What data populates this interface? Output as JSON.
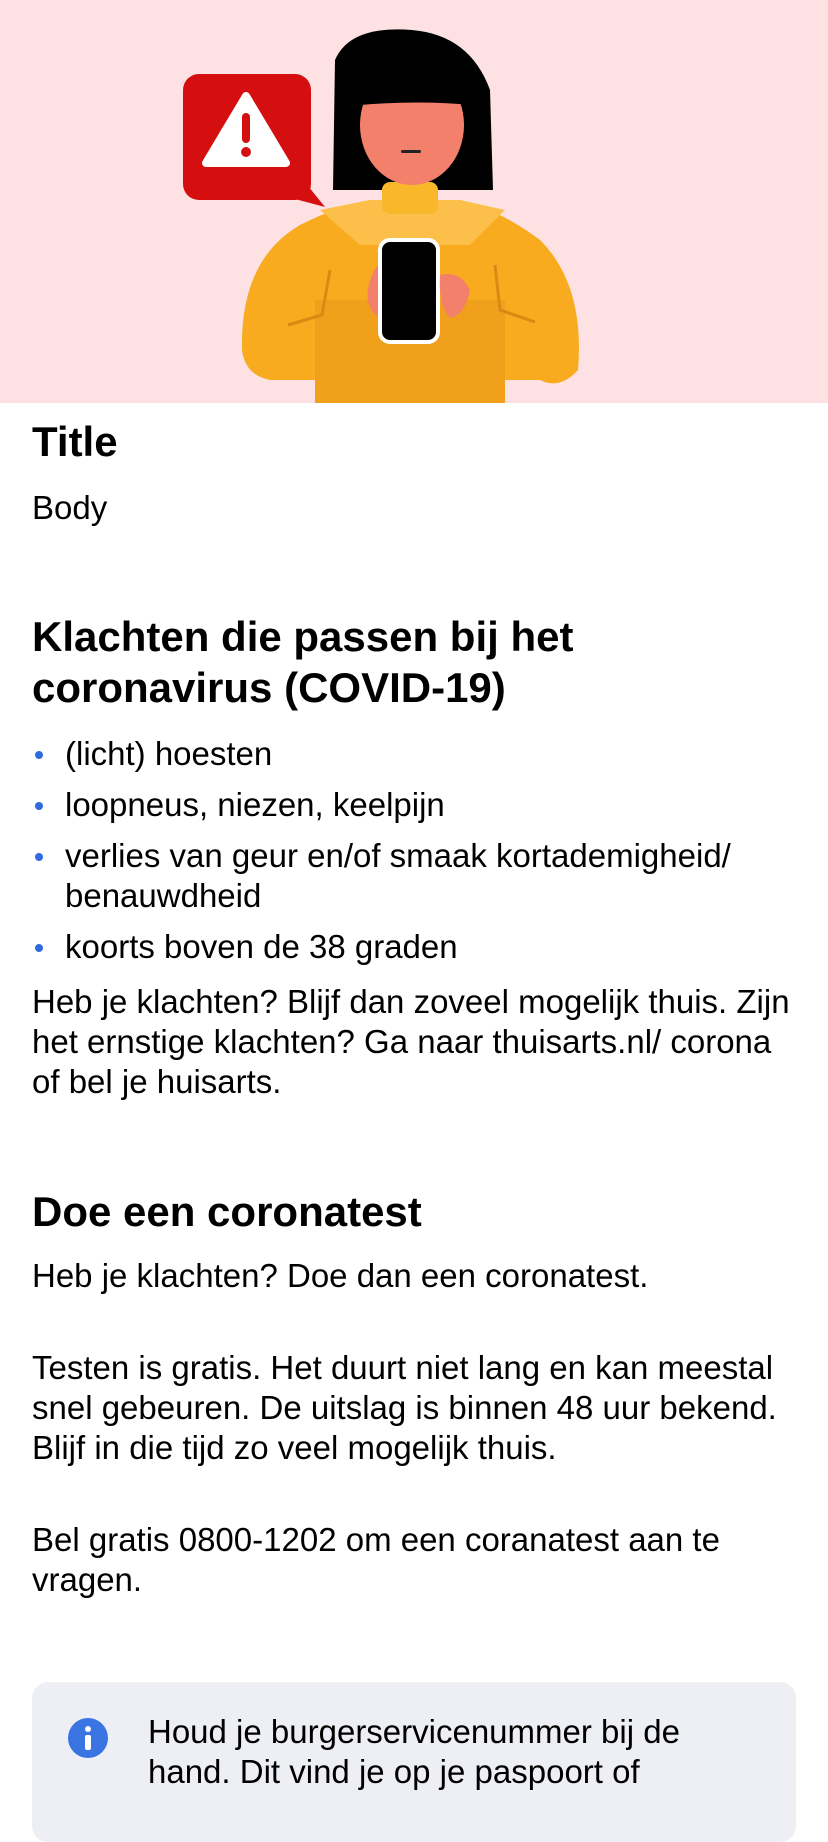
{
  "title": "Title",
  "body": "Body",
  "section1": {
    "heading": "Klachten die passen bij het coronavirus (COVID-19)",
    "bullets": [
      "(licht) hoesten",
      "loopneus, niezen, keelpijn",
      "verlies van geur en/of smaak kortademigheid/ benauwdheid",
      "koorts boven de 38 graden"
    ],
    "paragraph": "Heb je klachten? Blijf dan zoveel mogelijk thuis. Zijn het ernstige klachten? Ga naar thuisarts.nl/ corona of bel je huisarts."
  },
  "section2": {
    "heading": "Doe een coronatest",
    "paragraphs": [
      "Heb je klachten? Doe dan een coronatest.",
      "Testen is gratis. Het duurt niet lang en kan meestal snel gebeuren. De uitslag is binnen 48 uur bekend. Blijf in die tijd zo veel mogelijk thuis.",
      "Bel gratis 0800-1202 om een coranatest aan te vragen."
    ]
  },
  "info_box": {
    "icon": "info-icon",
    "text": "Houd je burgerservicenummer bij de hand. Dit vind je op je paspoort of"
  },
  "colors": {
    "hero_background": "#fde1e3",
    "bullet": "#2f6bdf",
    "info_box_background": "#eeeff4",
    "info_icon": "#3a73e2",
    "warning_red": "#d50f0f",
    "sweater": "#f8ab1e"
  }
}
